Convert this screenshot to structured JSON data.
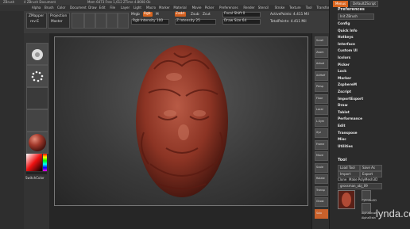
{
  "titlebar": {
    "app": "ZBrush",
    "document": "4 ZBrush Document",
    "info": "Mem 6473 Free 1,612 ZTime 4.8008 Ok"
  },
  "menubar": {
    "items": [
      "Alpha",
      "Brush",
      "Color",
      "Document",
      "Draw",
      "Edit",
      "File",
      "Layer",
      "Light",
      "Macro",
      "Marker",
      "Material",
      "Movie",
      "Picker",
      "Preferences",
      "Render",
      "Stencil",
      "Stroke",
      "Texture",
      "Tool",
      "Transform",
      "Zplugin",
      "Zscript",
      "Help"
    ]
  },
  "toolbar": {
    "zmapper_label": "ZMapper",
    "zmapper_sub": "rev-E",
    "projection_label": "Projection",
    "projection_sub": "Master",
    "mrgb": "Mrgb",
    "rgb": "Rgb",
    "m": "M",
    "rgb_intensity": "Rgb Intensity 100",
    "zadd": "Zadd",
    "zsub": "Zsub",
    "zcut": "Zcut",
    "z_intensity": "Z Intensity 25",
    "focal_shift": "Focal Shift 0",
    "draw_size": "Draw Size 64",
    "active_points": "ActivePoints: 4.411 Mil",
    "total_points": "TotalPoints: 4.411 Mil",
    "colors": {
      "active_orange": "#d8651f",
      "zadd_orange": "#d15e1e",
      "accent": "#c9612b"
    }
  },
  "panel": {
    "title": "Preferences",
    "quicksave": "DefaultZScript",
    "menu_button": "Menus",
    "init_zbrush": "Init ZBrush",
    "items": [
      "Config",
      "Quick Info",
      "Hotkeys",
      "Interface",
      "Custom UI",
      "Icolors",
      "Picker",
      "Lock",
      "Marker",
      "ZsphereM",
      "Zscript",
      "ImportExport",
      "Draw",
      "Tablet",
      "Performance",
      "Edit",
      "Transpose",
      "Misc",
      "Utilities"
    ],
    "tool_title": "Tool",
    "load_tool": "Load Tool",
    "save_as": "Save As",
    "import": "Import",
    "export": "Export",
    "clone": "Clone",
    "make_polymesh": "Make PolyMesh3D",
    "mesh_name": "grossman_obj_09",
    "subtools": [
      "Cylinder3D",
      "AlphaBrush",
      "AlphaTrain"
    ]
  },
  "lefttray": {
    "switch_color": "SwitchColor"
  },
  "righttray": {
    "labels": [
      "Scroll",
      "Zoom",
      "Actual",
      "AAHalf",
      "Persp",
      "Floor",
      "Local",
      "L.Sym",
      "Xyz",
      "Frame",
      "Move",
      "Scale",
      "Rotate",
      "Transp",
      "Ghost",
      "Solo"
    ]
  },
  "footer": {
    "watermark": "lynda.com"
  }
}
